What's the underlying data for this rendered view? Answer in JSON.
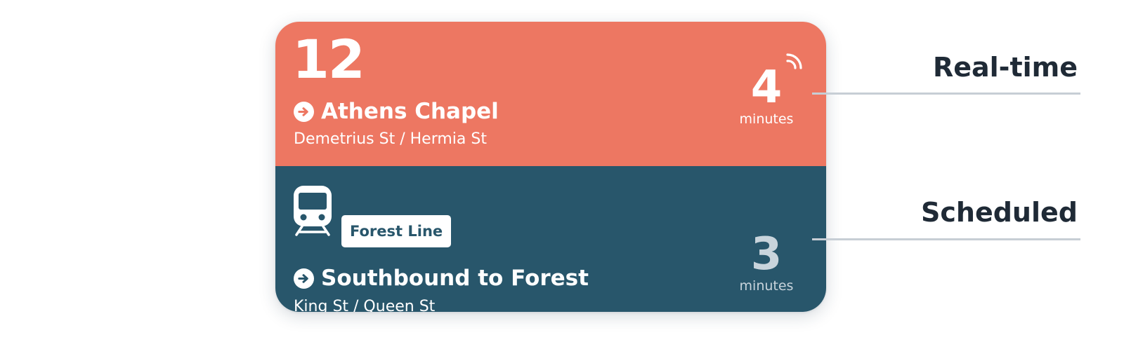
{
  "colors": {
    "realtime_bg": "#ed7762",
    "scheduled_bg": "#28566b",
    "scheduled_eta": "#c8d4dc",
    "divider": "#c7ced5",
    "label_text": "#1f2a36"
  },
  "realtime_row": {
    "route_number": "12",
    "destination": "Athens Chapel",
    "stop": "Demetrius St / Hermia St",
    "eta_value": "4",
    "eta_unit": "minutes",
    "icons": [
      "arrow-right-circle-icon",
      "realtime-signal-icon"
    ]
  },
  "scheduled_row": {
    "line_name": "Forest Line",
    "destination": "Southbound to Forest",
    "stop": "King St / Queen St",
    "eta_value": "3",
    "eta_unit": "minutes",
    "icons": [
      "train-icon",
      "arrow-right-circle-icon"
    ]
  },
  "labels": {
    "realtime": "Real-time",
    "scheduled": "Scheduled"
  }
}
